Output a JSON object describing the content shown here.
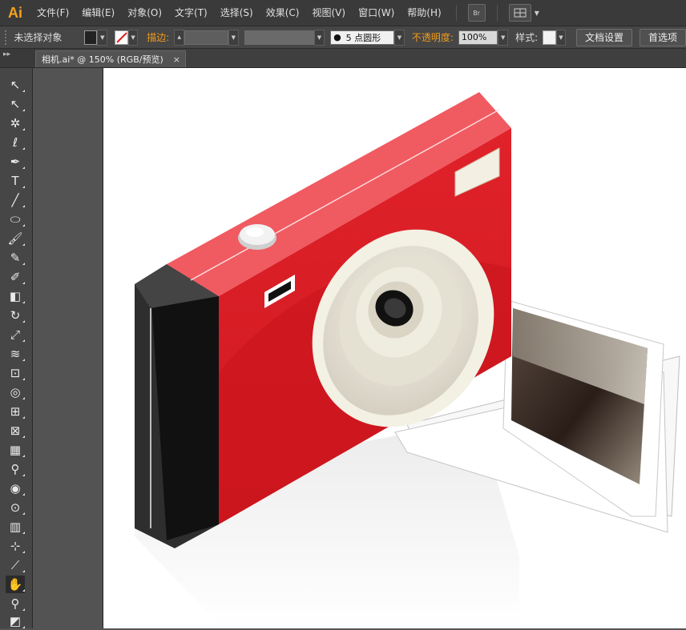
{
  "app": {
    "logo": "Ai"
  },
  "menu": {
    "items": [
      "文件(F)",
      "编辑(E)",
      "对象(O)",
      "文字(T)",
      "选择(S)",
      "效果(C)",
      "视图(V)",
      "窗口(W)",
      "帮助(H)"
    ],
    "bridge_label": "Br"
  },
  "control_bar": {
    "selection_status": "未选择对象",
    "stroke_label": "描边:",
    "brush_value": "5 点圆形",
    "opacity_label": "不透明度:",
    "opacity_value": "100%",
    "style_label": "样式:",
    "doc_setup_button": "文档设置",
    "preferences_button": "首选项"
  },
  "document_tab": {
    "title": "相机.ai* @ 150% (RGB/预览)",
    "close": "×"
  },
  "tools": [
    {
      "name": "selection-tool-icon",
      "glyph": "↖"
    },
    {
      "name": "direct-selection-tool-icon",
      "glyph": "↖"
    },
    {
      "name": "magic-wand-tool-icon",
      "glyph": "✲"
    },
    {
      "name": "lasso-tool-icon",
      "glyph": "ℓ"
    },
    {
      "name": "pen-tool-icon",
      "glyph": "✒"
    },
    {
      "name": "type-tool-icon",
      "glyph": "T"
    },
    {
      "name": "line-tool-icon",
      "glyph": "╱"
    },
    {
      "name": "ellipse-tool-icon",
      "glyph": "⬭"
    },
    {
      "name": "paintbrush-tool-icon",
      "glyph": "🖌"
    },
    {
      "name": "pencil-tool-icon",
      "glyph": "✎"
    },
    {
      "name": "blob-brush-tool-icon",
      "glyph": "✐"
    },
    {
      "name": "eraser-tool-icon",
      "glyph": "◧"
    },
    {
      "name": "rotate-tool-icon",
      "glyph": "↻"
    },
    {
      "name": "scale-tool-icon",
      "glyph": "⤢"
    },
    {
      "name": "width-tool-icon",
      "glyph": "≋"
    },
    {
      "name": "free-transform-tool-icon",
      "glyph": "⊡"
    },
    {
      "name": "shape-builder-tool-icon",
      "glyph": "◎"
    },
    {
      "name": "perspective-grid-tool-icon",
      "glyph": "⊞"
    },
    {
      "name": "mesh-tool-icon",
      "glyph": "⊠"
    },
    {
      "name": "gradient-tool-icon",
      "glyph": "▦"
    },
    {
      "name": "eyedropper-tool-icon",
      "glyph": "⚲"
    },
    {
      "name": "blend-tool-icon",
      "glyph": "◉"
    },
    {
      "name": "symbol-sprayer-tool-icon",
      "glyph": "⊙"
    },
    {
      "name": "column-graph-tool-icon",
      "glyph": "▥"
    },
    {
      "name": "artboard-tool-icon",
      "glyph": "⊹"
    },
    {
      "name": "slice-tool-icon",
      "glyph": "⟋"
    },
    {
      "name": "hand-tool-icon",
      "glyph": "✋"
    },
    {
      "name": "zoom-tool-icon",
      "glyph": "⚲"
    },
    {
      "name": "fill-stroke-icon",
      "glyph": "◩"
    }
  ],
  "colors": {
    "camera_red": "#e01c24",
    "camera_top": "#f25a5f",
    "lens_cream": "#efece0",
    "side_black": "#2e2e2e",
    "accent_orange": "#f29b1b"
  }
}
